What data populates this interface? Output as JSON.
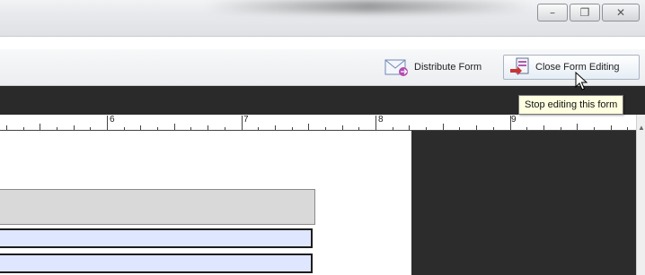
{
  "window": {
    "controls": {
      "minimize_icon": "–",
      "restore_icon": "❐",
      "close_icon": "✕"
    }
  },
  "toolbar": {
    "distribute_label": "Distribute Form",
    "close_editing_label": "Close Form Editing"
  },
  "tooltip": {
    "text": "Stop editing this form"
  },
  "ruler": {
    "labels": [
      "6",
      "7",
      "8",
      "9"
    ]
  },
  "colors": {
    "dark_band": "#2a2a2a",
    "tooltip_bg": "#ffffe1",
    "field_bg": "#dfe6ff",
    "panel": "#2c2c2c"
  }
}
